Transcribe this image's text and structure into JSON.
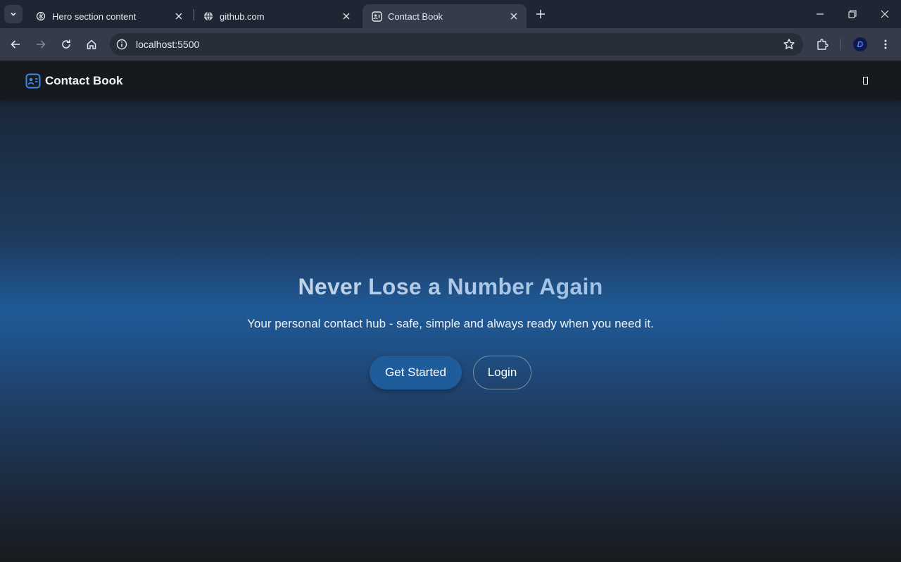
{
  "browser": {
    "tabs": [
      {
        "title": "Hero section content",
        "icon": "openai-icon",
        "active": false
      },
      {
        "title": "github.com",
        "icon": "globe-icon",
        "active": false
      },
      {
        "title": "Contact Book",
        "icon": "contact-card-icon",
        "active": true
      }
    ],
    "url": "localhost:5500",
    "profile_initial": "D"
  },
  "site": {
    "brand": "Contact Book",
    "hero": {
      "title": "Never Lose a Number Again",
      "subtitle": "Your personal contact hub - safe, simple and always ready when you need it.",
      "primary_button": "Get Started",
      "secondary_button": "Login"
    }
  },
  "colors": {
    "accent": "#1f5c9c",
    "brand_icon": "#3d8ae6",
    "nav_bg": "#16191d",
    "chrome_bg": "#1f2532",
    "toolbar_bg": "#353b4a"
  }
}
